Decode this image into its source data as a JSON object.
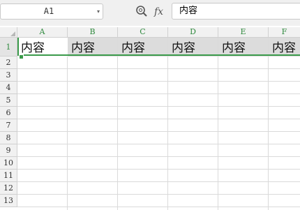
{
  "formula_bar": {
    "name_box": "A1",
    "fx_label": "fx",
    "formula_value": "内容"
  },
  "sheet": {
    "columns": [
      "A",
      "B",
      "C",
      "D",
      "E",
      "F"
    ],
    "rows": [
      "1",
      "2",
      "3",
      "4",
      "5",
      "6",
      "7",
      "8",
      "9",
      "10",
      "11",
      "12",
      "13"
    ],
    "row1_cells": [
      "内容",
      "内容",
      "内容",
      "内容",
      "内容",
      "内容"
    ],
    "selected_cell": "A1"
  },
  "colors": {
    "accent": "#3a9a4a",
    "header_text_selected": "#2f8a3e",
    "selection_fill": "#dcdcdc",
    "gridline": "#dadada"
  },
  "icons": [
    "zoom-icon",
    "dropdown-caret-icon",
    "select-all-icon",
    "fill-handle-icon"
  ]
}
